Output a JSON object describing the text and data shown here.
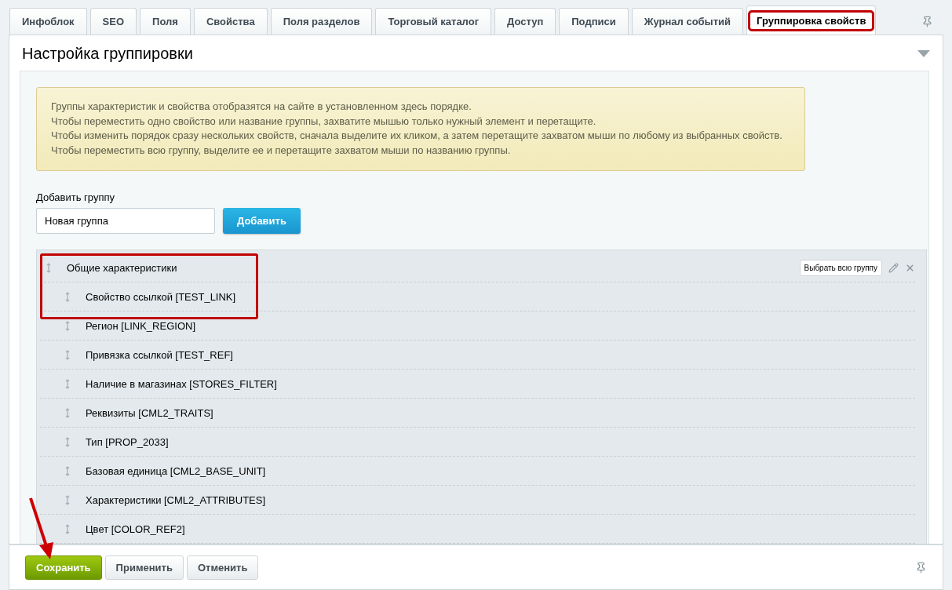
{
  "tabs": [
    {
      "label": "Инфоблок",
      "selected": false,
      "highlighted": false
    },
    {
      "label": "SEO",
      "selected": false,
      "highlighted": false
    },
    {
      "label": "Поля",
      "selected": false,
      "highlighted": false
    },
    {
      "label": "Свойства",
      "selected": false,
      "highlighted": false
    },
    {
      "label": "Поля разделов",
      "selected": false,
      "highlighted": false
    },
    {
      "label": "Торговый каталог",
      "selected": false,
      "highlighted": false
    },
    {
      "label": "Доступ",
      "selected": false,
      "highlighted": false
    },
    {
      "label": "Подписи",
      "selected": false,
      "highlighted": false
    },
    {
      "label": "Журнал событий",
      "selected": false,
      "highlighted": false
    },
    {
      "label": "Группировка свойств",
      "selected": true,
      "highlighted": true
    }
  ],
  "section": {
    "title": "Настройка группировки",
    "expanded": true
  },
  "notice": [
    "Группы характеристик и свойства отобразятся на сайте в установленном здесь порядке.",
    "Чтобы переместить одно свойство или название группы, захватите мышью только нужный элемент и перетащите.",
    "Чтобы изменить порядок сразу нескольких свойств, сначала выделите их кликом, а затем перетащите захватом мыши по любому из выбранных свойств.",
    "Чтобы переместить всю группу, выделите ее и перетащите захватом мыши по названию группы."
  ],
  "add_group": {
    "label": "Добавить группу",
    "value": "Новая группа",
    "button": "Добавить"
  },
  "group": {
    "name": "Общие характеристики",
    "select_all": "Выбрать всю группу",
    "highlighted": true,
    "children": [
      {
        "name": "Свойство ссылкой [TEST_LINK]"
      },
      {
        "name": "Регион [LINK_REGION]"
      },
      {
        "name": "Привязка ссылкой [TEST_REF]"
      },
      {
        "name": "Наличие в магазинах [STORES_FILTER]"
      },
      {
        "name": "Реквизиты [CML2_TRAITS]"
      },
      {
        "name": "Тип [PROP_2033]"
      },
      {
        "name": "Базовая единица [CML2_BASE_UNIT]"
      },
      {
        "name": "Характеристики [CML2_ATTRIBUTES]"
      },
      {
        "name": "Цвет [COLOR_REF2]"
      }
    ]
  },
  "footer": {
    "buttons": [
      {
        "label": "Сохранить",
        "kind": "primary"
      },
      {
        "label": "Применить",
        "kind": "plain"
      },
      {
        "label": "Отменить",
        "kind": "plain"
      }
    ],
    "arrow": true
  }
}
